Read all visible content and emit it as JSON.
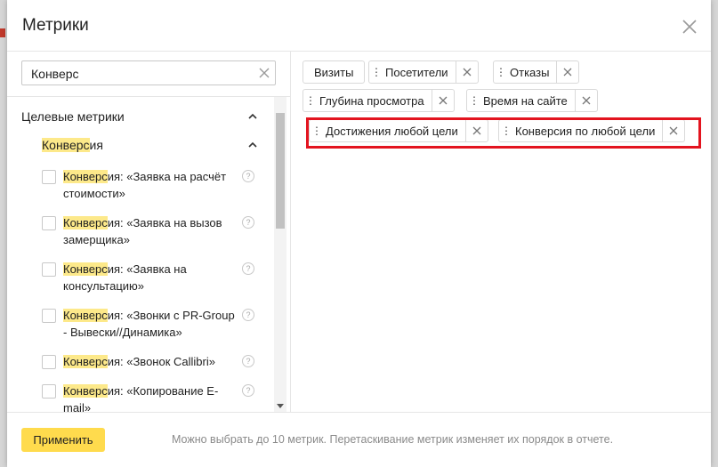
{
  "dialog": {
    "title": "Метрики",
    "close_icon": "close-icon"
  },
  "search": {
    "value": "Конверс",
    "clear_icon": "close-icon"
  },
  "tree": {
    "group": {
      "label": "Целевые метрики",
      "expanded": true
    },
    "subgroup": {
      "label_hl": "Конверс",
      "label_rest": "ия",
      "expanded": true
    },
    "items": [
      {
        "hl": "Конверс",
        "rest": "ия: «Заявка на расчёт стоимости»",
        "checked": false
      },
      {
        "hl": "Конверс",
        "rest": "ия: «Заявка на вызов замерщика»",
        "checked": false
      },
      {
        "hl": "Конверс",
        "rest": "ия: «Заявка на консультацию»",
        "checked": false
      },
      {
        "hl": "Конверс",
        "rest": "ия: «Звонки с PR-Group - Вывески//Динамика»",
        "checked": false
      },
      {
        "hl": "Конверс",
        "rest": "ия: «Звонок Callibri»",
        "checked": false
      },
      {
        "hl": "Конверс",
        "rest": "ия: «Копирование E-mail»",
        "checked": false
      }
    ]
  },
  "selected_metrics": [
    {
      "label": "Визиты",
      "removable": false
    },
    {
      "label": "Посетители",
      "removable": true
    },
    {
      "label": "Отказы",
      "removable": true
    },
    {
      "label": "Глубина просмотра",
      "removable": true
    },
    {
      "label": "Время на сайте",
      "removable": true
    },
    {
      "label": "Достижения любой цели",
      "removable": true
    },
    {
      "label": "Конверсия по любой цели",
      "removable": true
    }
  ],
  "footer": {
    "apply_label": "Применить",
    "hint": "Можно выбрать до 10 метрик. Перетаскивание метрик изменяет их порядок в отчете."
  },
  "colors": {
    "highlight": "#fde98a",
    "apply_button": "#ffdb4d",
    "annotation_box": "#e3141f"
  }
}
